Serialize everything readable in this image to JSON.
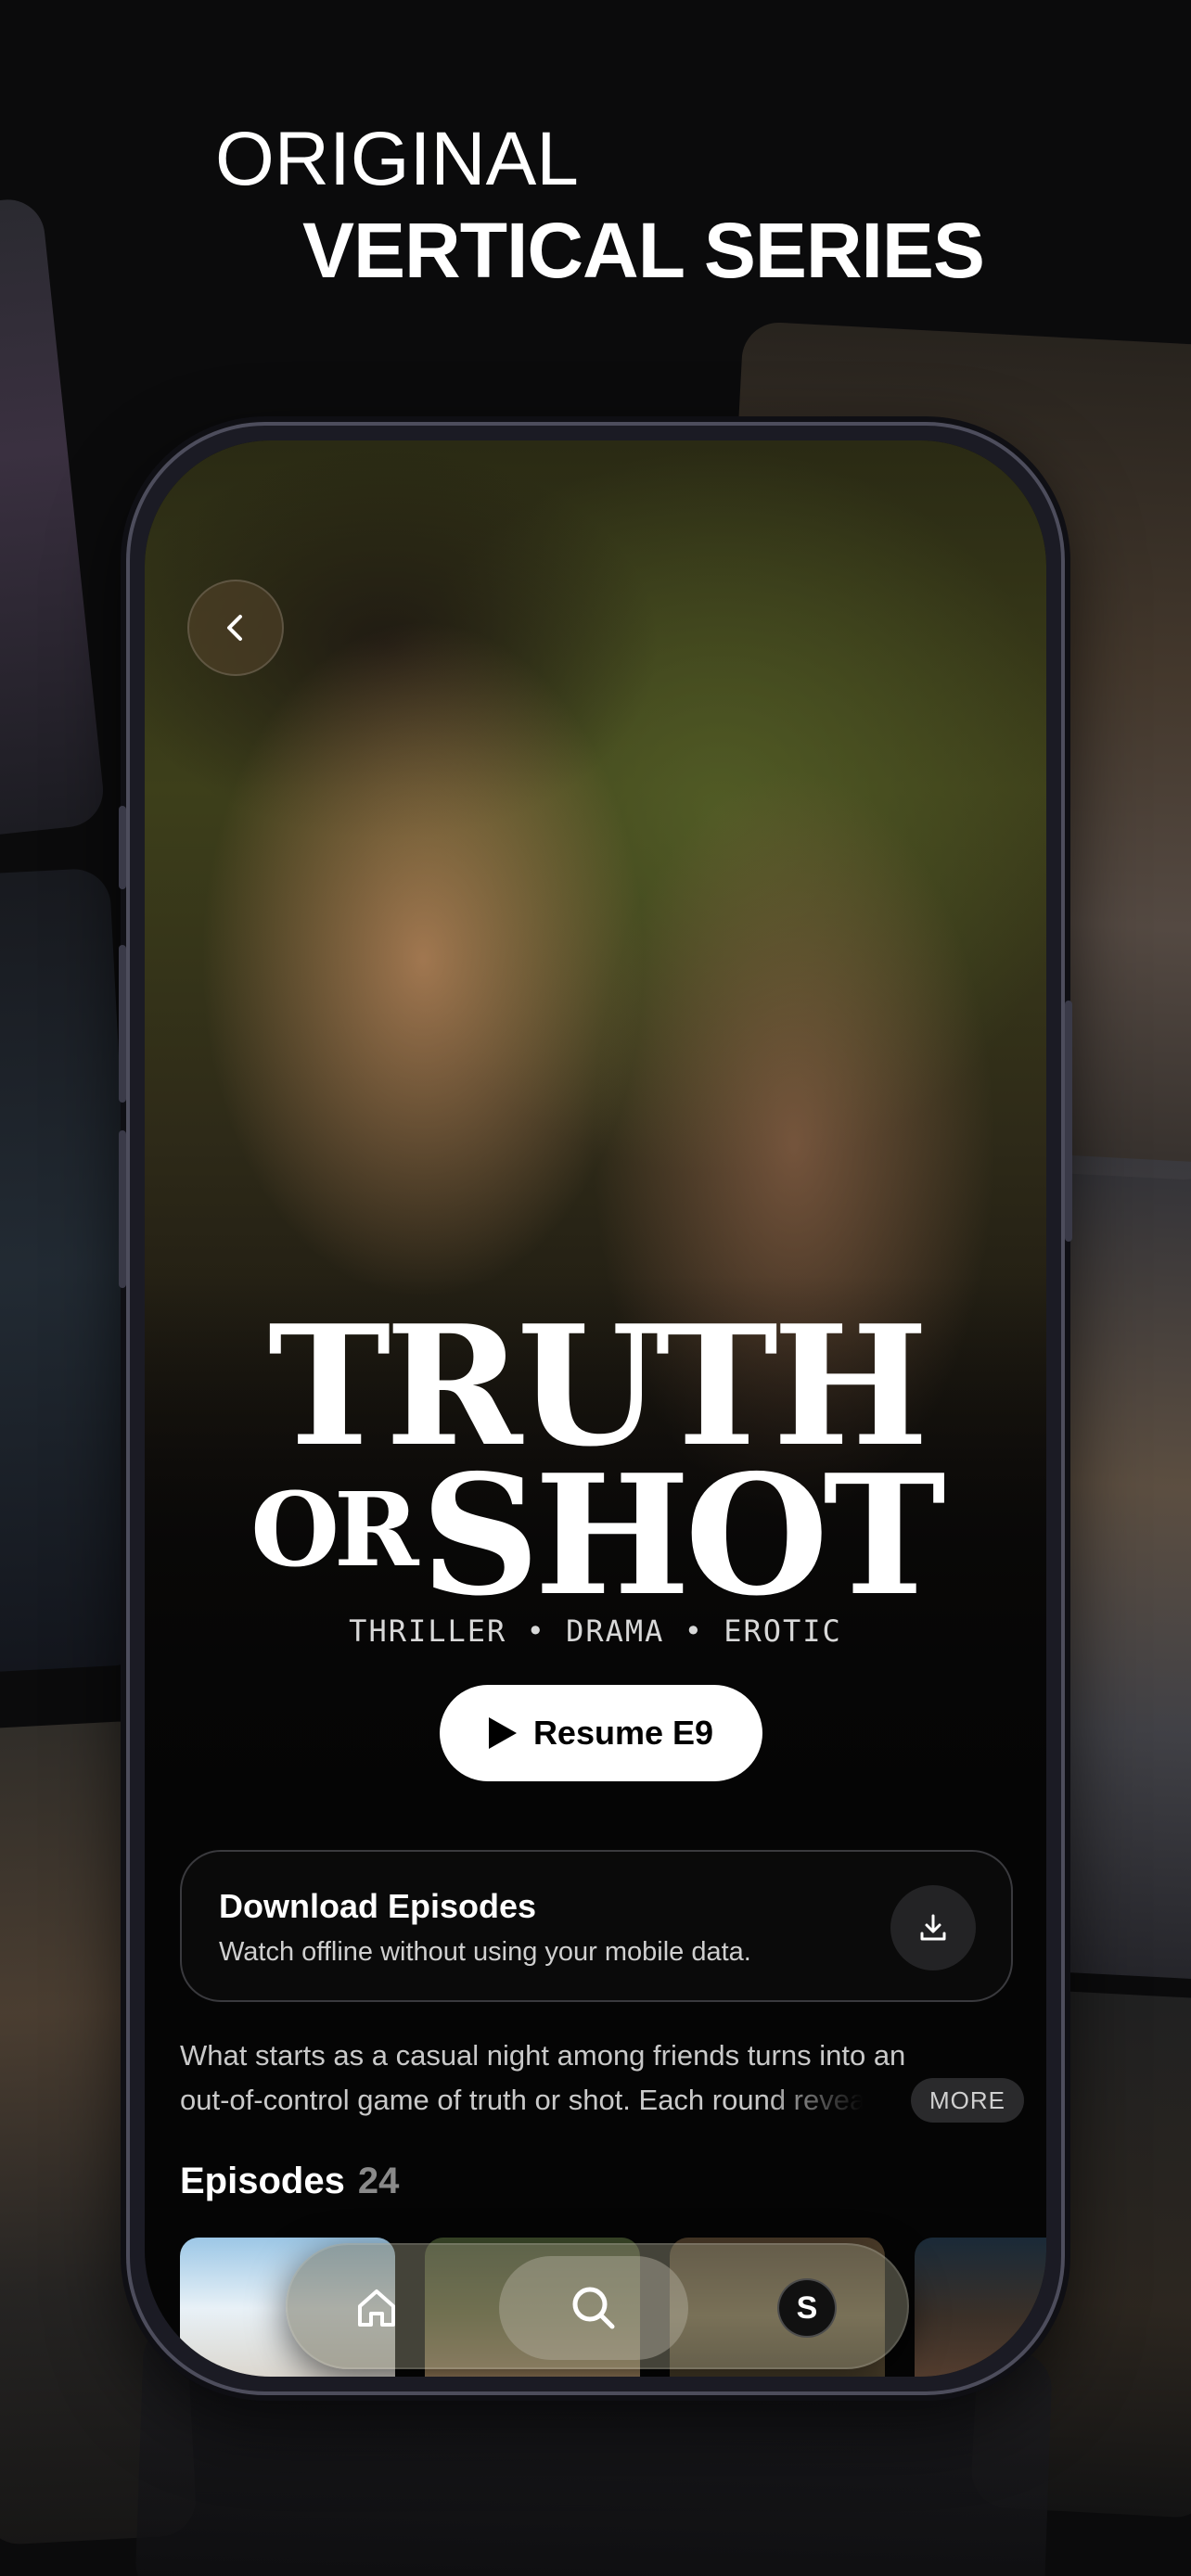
{
  "headline": {
    "line1": "ORIGINAL",
    "line2": "VERTICAL SERIES"
  },
  "show": {
    "title_line1": "TRUTH",
    "title_or": "OR",
    "title_line2": "SHOT",
    "genres": "THRILLER • DRAMA • EROTIC",
    "resume_label": "Resume E9"
  },
  "download": {
    "title": "Download Episodes",
    "subtitle": "Watch offline without using your mobile data."
  },
  "synopsis": {
    "line1": "What starts as a casual night among friends turns into an",
    "line2": "out-of-control game of truth or shot. Each round reveals",
    "more_label": "MORE"
  },
  "episodes": {
    "label": "Episodes",
    "count": "24"
  },
  "tabbar": {
    "items": [
      {
        "icon": "home-icon"
      },
      {
        "icon": "search-icon"
      },
      {
        "icon": "app-logo-icon",
        "glyph": "S"
      }
    ]
  },
  "colors": {
    "background": "#0b0b0c",
    "button_bg": "#ffffff",
    "card_border": "#3a3a3e"
  }
}
